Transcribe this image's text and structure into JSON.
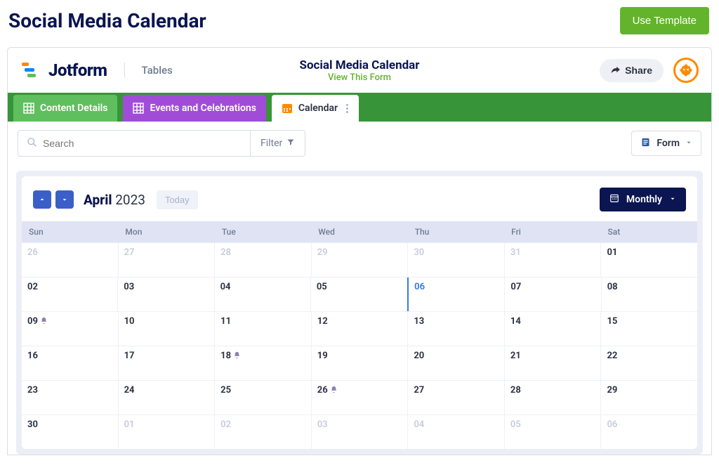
{
  "page": {
    "title": "Social Media Calendar"
  },
  "actions": {
    "use_template": "Use Template"
  },
  "header": {
    "brand": "Jotform",
    "brand_sub": "Tables",
    "form_title": "Social Media Calendar",
    "view_form": "View This Form",
    "share": "Share"
  },
  "tabs": {
    "content_details": "Content Details",
    "events": "Events and Celebrations",
    "calendar": "Calendar"
  },
  "toolbar": {
    "search_placeholder": "Search",
    "filter": "Filter",
    "form_dd": "Form"
  },
  "calendar": {
    "month": "April",
    "year": "2023",
    "today": "Today",
    "view": "Monthly",
    "day_headers": [
      "Sun",
      "Mon",
      "Tue",
      "Wed",
      "Thu",
      "Fri",
      "Sat"
    ],
    "weeks": [
      [
        {
          "n": "26",
          "out": true
        },
        {
          "n": "27",
          "out": true
        },
        {
          "n": "28",
          "out": true
        },
        {
          "n": "29",
          "out": true
        },
        {
          "n": "30",
          "out": true
        },
        {
          "n": "31",
          "out": true
        },
        {
          "n": "01"
        }
      ],
      [
        {
          "n": "02"
        },
        {
          "n": "03"
        },
        {
          "n": "04"
        },
        {
          "n": "05"
        },
        {
          "n": "06",
          "today": true
        },
        {
          "n": "07"
        },
        {
          "n": "08"
        }
      ],
      [
        {
          "n": "09",
          "bell": true
        },
        {
          "n": "10"
        },
        {
          "n": "11"
        },
        {
          "n": "12"
        },
        {
          "n": "13"
        },
        {
          "n": "14"
        },
        {
          "n": "15"
        }
      ],
      [
        {
          "n": "16"
        },
        {
          "n": "17"
        },
        {
          "n": "18",
          "bell": true
        },
        {
          "n": "19"
        },
        {
          "n": "20"
        },
        {
          "n": "21"
        },
        {
          "n": "22"
        }
      ],
      [
        {
          "n": "23"
        },
        {
          "n": "24"
        },
        {
          "n": "25"
        },
        {
          "n": "26",
          "bell": true
        },
        {
          "n": "27"
        },
        {
          "n": "28"
        },
        {
          "n": "29"
        }
      ],
      [
        {
          "n": "30"
        },
        {
          "n": "01",
          "out": true
        },
        {
          "n": "02",
          "out": true
        },
        {
          "n": "03",
          "out": true
        },
        {
          "n": "04",
          "out": true
        },
        {
          "n": "05",
          "out": true
        },
        {
          "n": "06",
          "out": true
        }
      ]
    ]
  }
}
